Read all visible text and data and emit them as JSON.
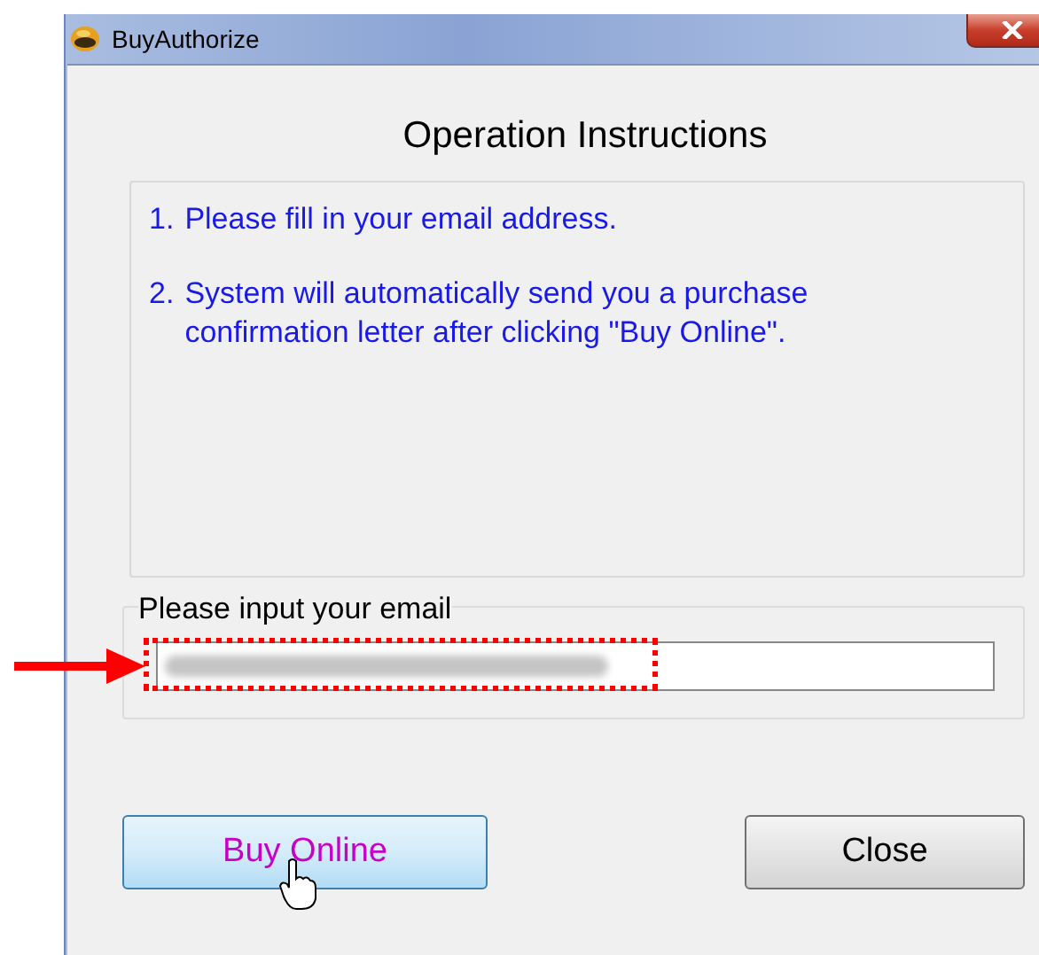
{
  "window": {
    "title": "BuyAuthorize"
  },
  "heading": "Operation Instructions",
  "instructions": [
    {
      "number": "1.",
      "text": "Please fill in your email address."
    },
    {
      "number": "2.",
      "text": "System will automatically send you a purchase confirmation letter after clicking \"Buy Online\"."
    }
  ],
  "email": {
    "label": "Please input your email",
    "redacted": true,
    "highlighted": true
  },
  "buttons": [
    {
      "label": "Buy Online",
      "hovered": true
    },
    {
      "label": "Close",
      "hovered": false
    }
  ]
}
